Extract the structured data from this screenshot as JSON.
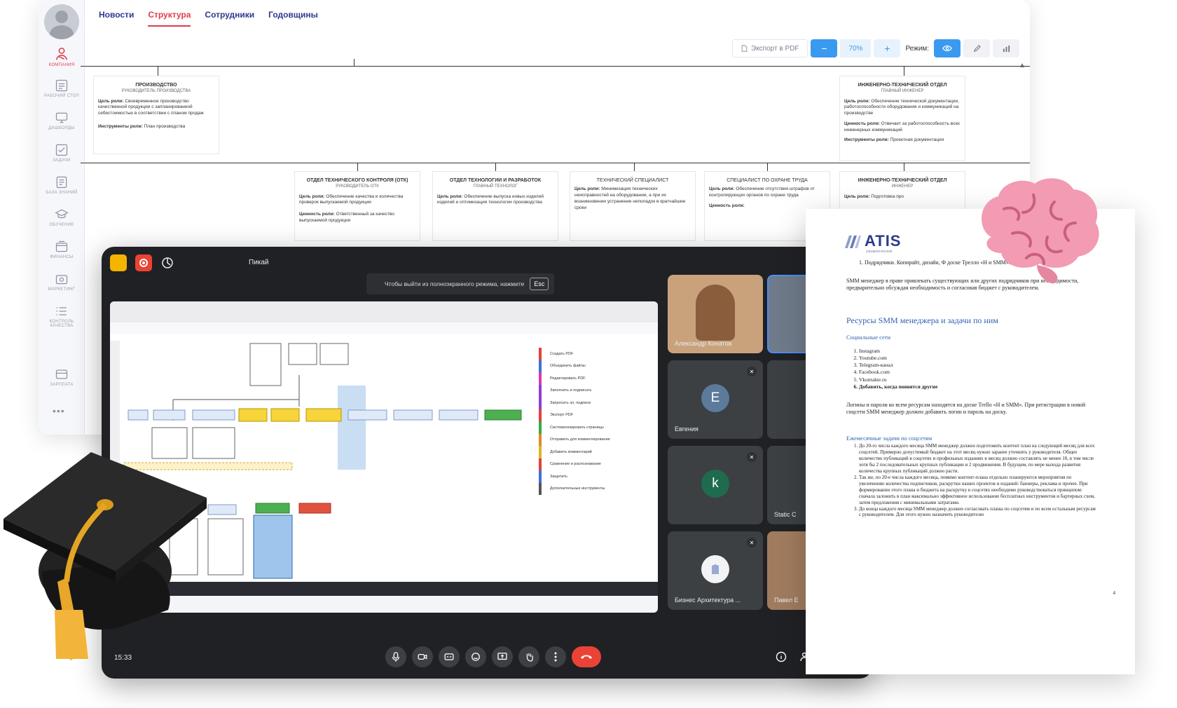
{
  "org_app": {
    "sidebar": [
      {
        "label": "КОМПАНИЯ",
        "icon": "company-icon"
      },
      {
        "label": "РАБОЧИЙ СТОЛ",
        "icon": "desktop-icon"
      },
      {
        "label": "ДАШБОРДЫ",
        "icon": "monitor-icon"
      },
      {
        "label": "ЗАДАЧИ",
        "icon": "checkbox-icon"
      },
      {
        "label": "БАЗА ЗНАНИЙ",
        "icon": "book-icon"
      },
      {
        "label": "ОБУЧЕНИЕ",
        "icon": "cap-icon"
      },
      {
        "label": "ФИНАНСЫ",
        "icon": "wallet-icon"
      },
      {
        "label": "МАРКЕТИНГ",
        "icon": "camera-icon"
      },
      {
        "label": "КОНТРОЛЬ КАЧЕСТВА",
        "icon": "list-icon"
      },
      {
        "label": "ЗАРПЛАТА",
        "icon": "card-icon"
      }
    ],
    "tabs": [
      "Новости",
      "Структура",
      "Сотрудники",
      "Годовщины"
    ],
    "toolbar": {
      "export": "Экспорт в PDF",
      "minus": "−",
      "zoom": "70%",
      "plus": "+",
      "mode": "Режим:"
    },
    "cards": [
      {
        "title": "ПРОИЗВОДСТВО",
        "subtitle": "РУКОВОДИТЕЛЬ ПРОИЗВОДСТВА",
        "goal_label": "Цель роли:",
        "goal": "Своевременное производство качественной продукции с запланированной себестоимостью в соответствии с планом продаж",
        "tools_label": "Инструменты роли:",
        "tools": "План производства"
      },
      {
        "title": "ИНЖЕНЕРНО-ТЕХНИЧЕСКИЙ ОТДЕЛ",
        "subtitle": "ГЛАВНЫЙ ИНЖЕНЕР",
        "goal_label": "Цель роли:",
        "goal": "Обеспечение технической документации, работоспособности оборудования и коммуникаций на производстве",
        "value_label": "Ценность роли:",
        "value": "Отвечает за работоспособность всех инженерных коммуникаций",
        "tools_label": "Инструменты роли:",
        "tools": "Проектная документация"
      },
      {
        "title": "ОТДЕЛ ТЕХНИЧЕСКОГО КОНТРОЛЯ (ОТК)",
        "subtitle": "РУКОВОДИТЕЛЬ ОТК",
        "goal_label": "Цель роли:",
        "goal": "Обеспечение качества и количества проверок выпускаемой продукции",
        "value_label": "Ценность роли:",
        "value": "Ответственный за качество выпускаемой продукции"
      },
      {
        "title": "ОТДЕЛ ТЕХНОЛОГИИ И РАЗРАБОТОК",
        "subtitle": "ГЛАВНЫЙ ТЕХНОЛОГ",
        "goal_label": "Цель роли:",
        "goal": "Обеспечение выпуска новых изделий изделий и оптимизация технологии производства"
      },
      {
        "title": "ТЕХНИЧЕСКИЙ СПЕЦИАЛИСТ",
        "subtitle": "",
        "goal_label": "Цель роли:",
        "goal": "Минимизация технических неисправностей на оборудовании, а при их возникновении устранение неполадок в кратчайшие сроки"
      },
      {
        "title": "СПЕЦИАЛИСТ ПО ОХРАНЕ ТРУДА",
        "subtitle": "",
        "goal_label": "Цель роли:",
        "goal": "Обеспечение отсутствия штрафов от контролирующих органов по охране труда",
        "value_label": "Ценность роли:",
        "value": ""
      },
      {
        "title": "ИНЖЕНЕРНО-ТЕХНИЧЕСКИЙ ОТДЕЛ",
        "subtitle": "ИНЖЕНЕР",
        "goal_label": "Цель роли:",
        "goal": "Подготовка про"
      }
    ]
  },
  "meet": {
    "title": "Пикай",
    "fullscreen_hint": "Чтобы выйти из полноэкранного режима, нажмите",
    "esc_key": "Esc",
    "time": "15:33",
    "participants": [
      {
        "name": "Александр Конатов",
        "initial": "",
        "color": "#c9a27c"
      },
      {
        "name": "",
        "initial": "",
        "color": "#6f7a8a"
      },
      {
        "name": "Евгения",
        "initial": "E",
        "color": "#5c7b9b"
      },
      {
        "name": "",
        "initial": "",
        "color": "#3c4043"
      },
      {
        "name": "",
        "initial": "k",
        "color": "#1e6b4e"
      },
      {
        "name": "Static C",
        "initial": "",
        "color": "#3c4043"
      },
      {
        "name": "Бизнес Архитектура ...",
        "initial": "",
        "color": "#f1f3f4"
      },
      {
        "name": "Павел Е",
        "initial": "",
        "color": "#a07b5e"
      }
    ],
    "shared_screen": {
      "sidebar_items": [
        "Создать PDF",
        "Объединить файлы",
        "Редактировать PDF",
        "Заполнить и подписать",
        "Запросить эл. подписи",
        "Экспорт PDF",
        "Систематизировать страницы",
        "Отправить для комментирования",
        "Добавить комментарий",
        "Сравнение и распознавание",
        "Защитить",
        "Дополнительные инструменты"
      ]
    }
  },
  "doc": {
    "logo": "ATIS",
    "logo_sub": "управленческая",
    "item1": "Подрядчики. Копирайт, дизайн, Ф доске Трелло «Н и SMM».",
    "para1": "SMM менеджер в праве привлекать существующих или других подрядчиков при необходимости, предварительно обсуждая необходимость и согласовав бюджет с руководителем.",
    "h1": "Ресурсы SMM менеджера и задачи по ним",
    "sub1": "Социальные сети",
    "socials": [
      "Instagram",
      "Youtube.com",
      "Telegram-канал",
      "Facebook.com",
      "Vkontakte.ru",
      "Добавить, когда появятся другие"
    ],
    "para2": "Логины и пароли ко всем ресурсам находятся на доске Trello «Н и SMM». При регистрации в новой соцсети SMM менеджер должен добавить логин и пароль на доску.",
    "sub2": "Ежемесячные задачи по соцсетям",
    "tasks": [
      "До 20-го числа каждого месяца SMM менеджер должен подготовить контент план на следующий месяц для всех соцсетей. Примерно допустимый бюджет на этот месяц нужно заранее уточнить у руководителя. Общее количество публикаций в соцсетях и профильных изданиях в месяц должно составлять не менее 10, в том числе хотя бы 2 последовательных крупных публикации и 2 продвижения. В будущем, по мере выхода развития количества крупных публикаций должно расти.",
      "Так же, по 20-е числа каждого месяца, помимо контент-плана отдельно планируются мероприятия по увеличению количества подписчиков, раскрутки наших проектов и изданий: баннеры, реклама и прочее. При формировании этого плана и бюджета на раскрутку в соцсетях необходимо руководствоваться принципом: сначала заложить в план максимально эффективное использование бесплатных инструментов и бартерных схем, затем предложения с минимальными затратами.",
      "До конца каждого месяца SMM менеджер должен согласовать планы по соцсетям и по всем остальным ресурсам с руководителем. Для этого нужно назначить руководителю"
    ],
    "page": "4"
  }
}
